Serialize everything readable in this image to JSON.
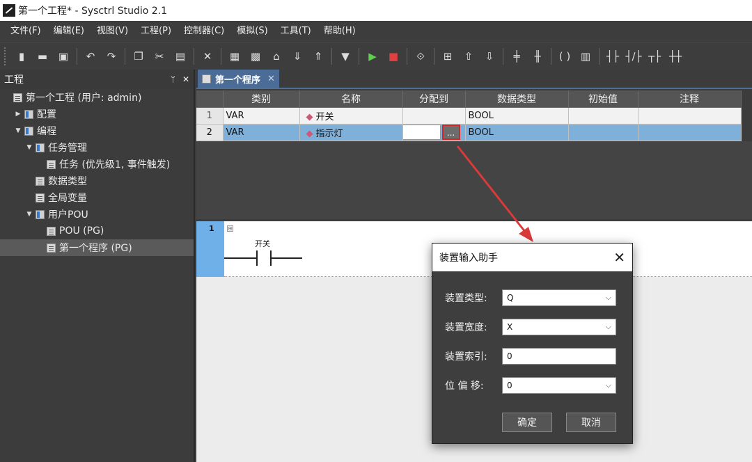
{
  "window": {
    "title": "第一个工程* - Sysctrl Studio 2.1"
  },
  "menu": [
    "文件(F)",
    "编辑(E)",
    "视图(V)",
    "工程(P)",
    "控制器(C)",
    "模拟(S)",
    "工具(T)",
    "帮助(H)"
  ],
  "toolbar": [
    {
      "icon": "new-file-icon",
      "glyph": "▮"
    },
    {
      "icon": "open-folder-icon",
      "glyph": "▬"
    },
    {
      "icon": "save-icon",
      "glyph": "▣"
    },
    {
      "icon": "undo-icon",
      "glyph": "↶"
    },
    {
      "icon": "redo-icon",
      "glyph": "↷"
    },
    {
      "icon": "copy-icon",
      "glyph": "❐"
    },
    {
      "icon": "cut-icon",
      "glyph": "✂"
    },
    {
      "icon": "paste-icon",
      "glyph": "▤"
    },
    {
      "icon": "delete-icon",
      "glyph": "✕"
    },
    {
      "icon": "build-icon",
      "glyph": "▦"
    },
    {
      "icon": "compile-icon",
      "glyph": "▩"
    },
    {
      "icon": "clean-icon",
      "glyph": "⌂"
    },
    {
      "icon": "download-icon",
      "glyph": "⇓"
    },
    {
      "icon": "upload-icon",
      "glyph": "⇑"
    },
    {
      "icon": "monitor-icon",
      "glyph": "▼"
    },
    {
      "icon": "run-icon",
      "glyph": "▶"
    },
    {
      "icon": "stop-icon",
      "glyph": "■"
    },
    {
      "icon": "online-icon",
      "glyph": "⟐"
    },
    {
      "icon": "insert-rung-icon",
      "glyph": "⊞"
    },
    {
      "icon": "move-up-icon",
      "glyph": "⇧"
    },
    {
      "icon": "move-down-icon",
      "glyph": "⇩"
    },
    {
      "icon": "branch-icon",
      "glyph": "╪"
    },
    {
      "icon": "parallel-icon",
      "glyph": "╫"
    },
    {
      "icon": "coil-icon",
      "glyph": "( )"
    },
    {
      "icon": "function-block-icon",
      "glyph": "▥"
    },
    {
      "icon": "contact-no-icon",
      "glyph": "┤├"
    },
    {
      "icon": "contact-nc-icon",
      "glyph": "┤/├"
    },
    {
      "icon": "contact-p-icon",
      "glyph": "┬├"
    },
    {
      "icon": "contact-n-icon",
      "glyph": "┼┼"
    }
  ],
  "project_panel": {
    "title": "工程",
    "pin": "ᛘ",
    "close": "✕",
    "tree": [
      {
        "label": "第一个工程 (用户: admin)",
        "caret": "",
        "indent": 0,
        "icon": "project-icon"
      },
      {
        "label": "配置",
        "caret": "▶",
        "indent": 1,
        "icon": "config-icon"
      },
      {
        "label": "编程",
        "caret": "▼",
        "indent": 1,
        "icon": "programming-icon"
      },
      {
        "label": "任务管理",
        "caret": "▼",
        "indent": 2,
        "icon": "task-manager-icon"
      },
      {
        "label": "任务 (优先级1, 事件触发)",
        "caret": "",
        "indent": 3,
        "icon": "task-icon"
      },
      {
        "label": "数据类型",
        "caret": "",
        "indent": 2,
        "icon": "datatype-icon"
      },
      {
        "label": "全局变量",
        "caret": "",
        "indent": 2,
        "icon": "global-var-icon"
      },
      {
        "label": "用户POU",
        "caret": "▼",
        "indent": 2,
        "icon": "pou-folder-icon"
      },
      {
        "label": "POU (PG)",
        "caret": "",
        "indent": 3,
        "icon": "pou-icon"
      },
      {
        "label": "第一个程序 (PG)",
        "caret": "",
        "indent": 3,
        "icon": "program-icon",
        "selected": true
      }
    ]
  },
  "editor": {
    "tab_label": "第一个程序",
    "tab_close": "✕",
    "columns": [
      "类别",
      "名称",
      "分配到",
      "数据类型",
      "初始值",
      "注释"
    ],
    "rows": [
      {
        "num": "1",
        "category": "VAR",
        "name": "开关",
        "assign": "",
        "type": "BOOL",
        "init": "",
        "comment": ""
      },
      {
        "num": "2",
        "category": "VAR",
        "name": "指示灯",
        "assign": "",
        "type": "BOOL",
        "init": "",
        "comment": ""
      }
    ],
    "ellipsis": "...",
    "ld": {
      "rung_number": "1",
      "expand": "⊞",
      "contact_label": "开关"
    }
  },
  "dialog": {
    "title": "装置输入助手",
    "close": "✕",
    "fields": {
      "device_type": {
        "label": "装置类型:",
        "value": "Q"
      },
      "device_width": {
        "label": "装置宽度:",
        "value": "X"
      },
      "device_index": {
        "label": "装置索引:",
        "value": "0"
      },
      "bit_offset": {
        "label": "位 偏 移:",
        "value": "0"
      }
    },
    "ok": "确定",
    "cancel": "取消"
  },
  "colors": {
    "annotation": "#d93a3a",
    "selection": "#7fb0d9",
    "tab": "#4a6c96"
  }
}
